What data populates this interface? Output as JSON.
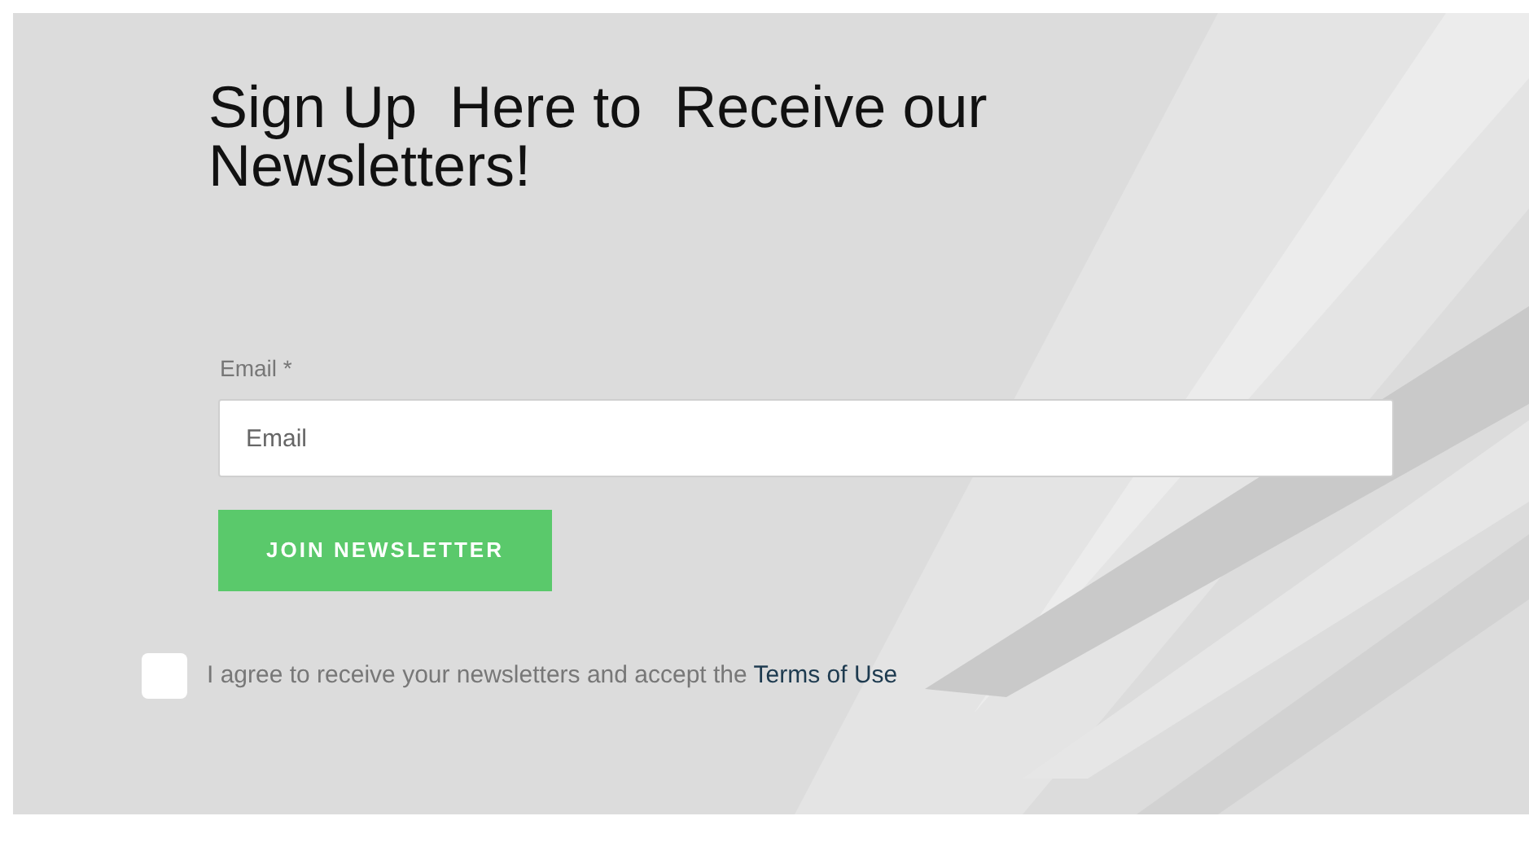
{
  "heading": "Sign Up  Here to  Receive our Newsletters!",
  "form": {
    "email_label": "Email *",
    "email_field": {
      "placeholder": "Email"
    },
    "submit_button": "JOIN NEWSLETTER"
  },
  "consent": {
    "checked": false,
    "text": "I agree to receive your newsletters and accept the",
    "link": "Terms of Use"
  }
}
